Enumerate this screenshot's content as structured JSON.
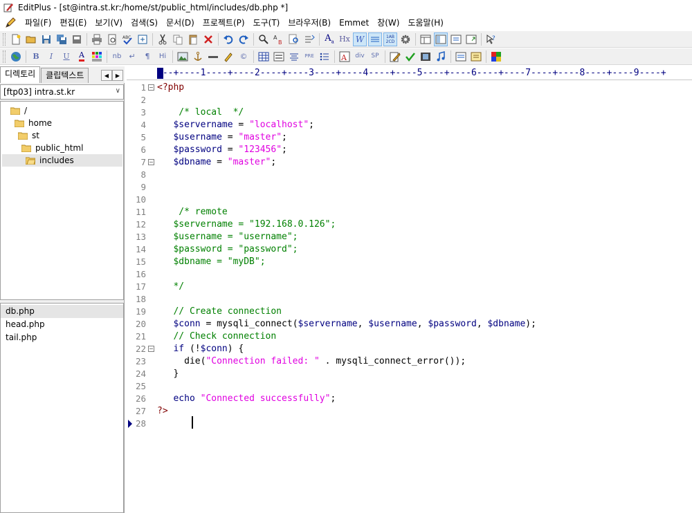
{
  "window": {
    "title": "EditPlus - [st@intra.st.kr:/home/st/public_html/includes/db.php *]"
  },
  "menu": [
    "파일(F)",
    "편집(E)",
    "보기(V)",
    "검색(S)",
    "문서(D)",
    "프로젝트(P)",
    "도구(T)",
    "브라우저(B)",
    "Emmet",
    "창(W)",
    "도움말(H)"
  ],
  "panel": {
    "tabs": [
      "디렉토리",
      "클립텍스트"
    ],
    "drive": "[ftp03] intra.st.kr",
    "tree": [
      "/",
      "home",
      "st",
      "public_html",
      "includes"
    ],
    "files": [
      "db.php",
      "head.php",
      "tail.php"
    ]
  },
  "editor": {
    "ruler": "---+----1----+----2----+----3----+----4----+----5----+----6----+----7----+----8----+----9----+",
    "line_numbers": [
      "1",
      "2",
      "3",
      "4",
      "5",
      "6",
      "7",
      "8",
      "9",
      "10",
      "11",
      "12",
      "13",
      "14",
      "15",
      "16",
      "17",
      "18",
      "19",
      "20",
      "21",
      "22",
      "23",
      "24",
      "25",
      "26",
      "27",
      "28"
    ]
  },
  "colors": {
    "keyword": "#000080",
    "string": "#e000e0",
    "comment": "#008000",
    "php_tag": "#800000"
  }
}
